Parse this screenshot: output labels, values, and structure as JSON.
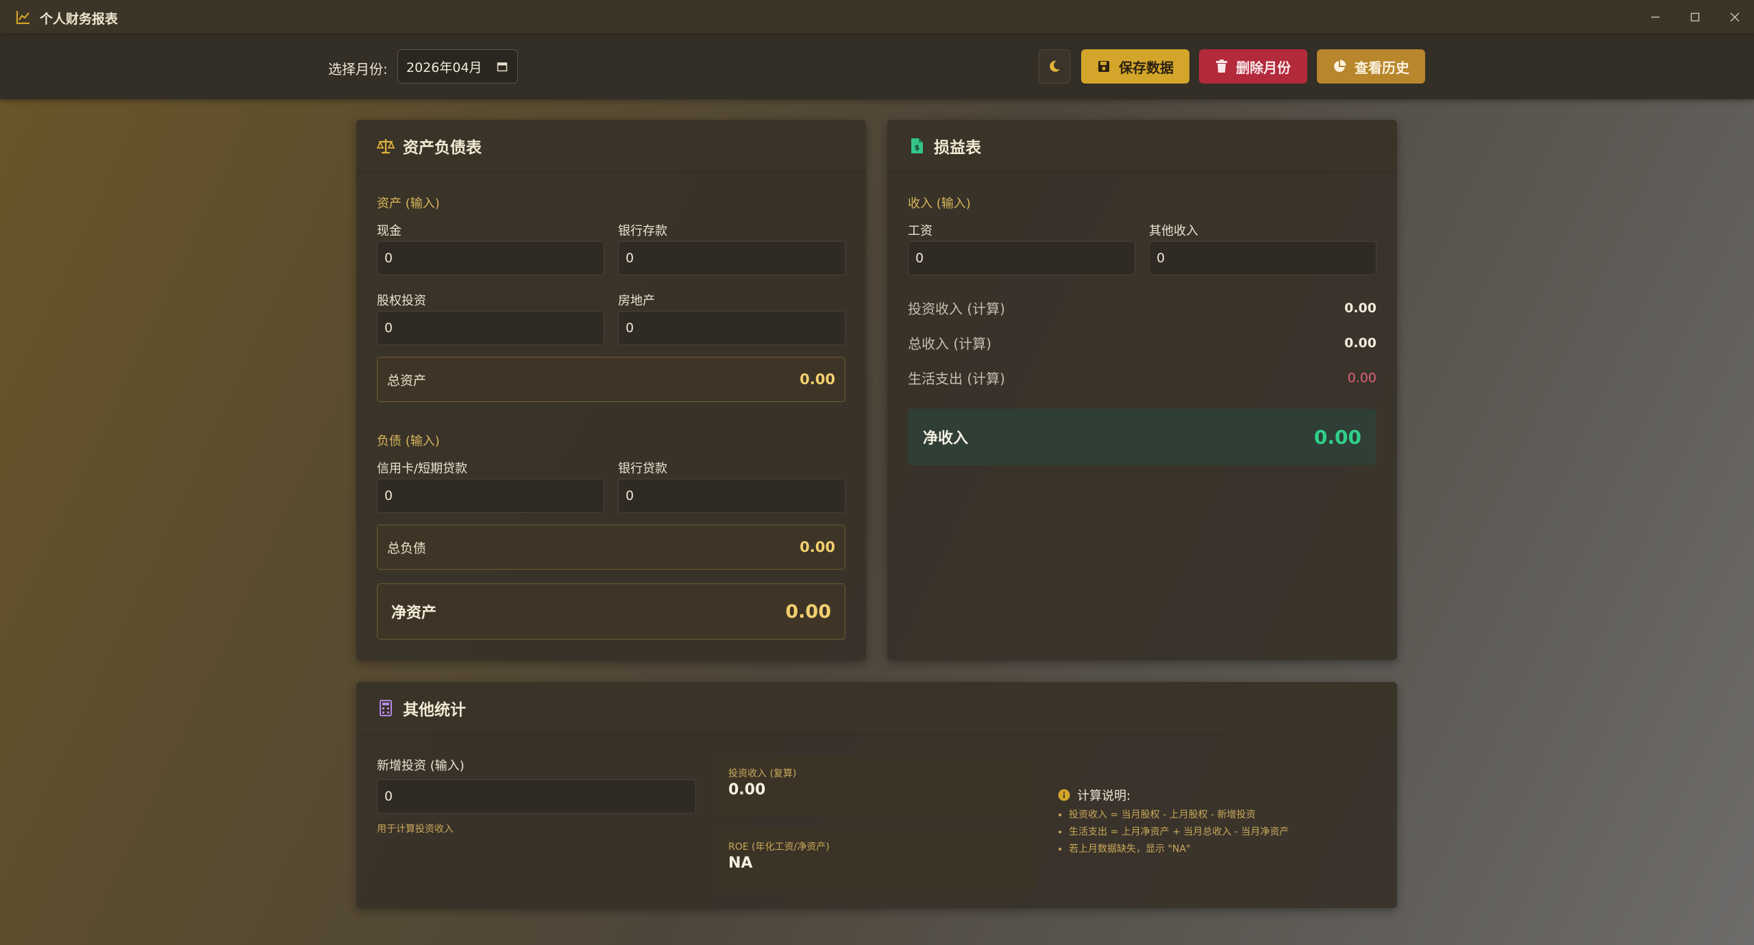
{
  "window": {
    "title": "个人财务报表"
  },
  "toolbar": {
    "month_label": "选择月份:",
    "month_value": "2026年04月",
    "save_label": "保存数据",
    "delete_label": "删除月份",
    "history_label": "查看历史"
  },
  "balance_sheet": {
    "title": "资产负债表",
    "assets_section": "资产 (输入)",
    "cash_label": "现金",
    "cash_value": "0",
    "bank_deposit_label": "银行存款",
    "bank_deposit_value": "0",
    "equity_label": "股权投资",
    "equity_value": "0",
    "real_estate_label": "房地产",
    "real_estate_value": "0",
    "total_assets_label": "总资产",
    "total_assets_value": "0.00",
    "liabilities_section": "负债 (输入)",
    "credit_label": "信用卡/短期贷款",
    "credit_value": "0",
    "bank_loan_label": "银行贷款",
    "bank_loan_value": "0",
    "total_liabilities_label": "总负债",
    "total_liabilities_value": "0.00",
    "net_assets_label": "净资产",
    "net_assets_value": "0.00"
  },
  "income_statement": {
    "title": "损益表",
    "income_section": "收入 (输入)",
    "salary_label": "工资",
    "salary_value": "0",
    "other_income_label": "其他收入",
    "other_income_value": "0",
    "investment_income_label": "投资收入 (计算)",
    "investment_income_value": "0.00",
    "total_income_label": "总收入 (计算)",
    "total_income_value": "0.00",
    "living_expense_label": "生活支出 (计算)",
    "living_expense_value": "0.00",
    "net_income_label": "净收入",
    "net_income_value": "0.00"
  },
  "other_stats": {
    "title": "其他统计",
    "new_investment_label": "新增投资 (输入)",
    "new_investment_value": "0",
    "new_investment_hint": "用于计算投资收入",
    "investment_income_label": "投资收入 (复算)",
    "investment_income_value": "0.00",
    "roe_label": "ROE (年化工资/净资产)",
    "roe_value": "NA",
    "notes_title": "计算说明:",
    "notes": [
      "投资收入 = 当月股权 - 上月股权 - 新增投资",
      "生活支出 = 上月净资产 + 当月总收入 - 当月净资产",
      "若上月数据缺失，显示 \"NA\""
    ]
  },
  "colors": {
    "accent_gold": "#d3a52a",
    "danger": "#b32a3b",
    "history": "#b8862c",
    "positive_green": "#2fd08a",
    "expense_red": "#e0627a"
  },
  "icons": {
    "app": "chart-line-icon",
    "theme": "moon-icon",
    "save": "floppy-icon",
    "delete": "trash-icon",
    "history": "pie-chart-icon",
    "balance": "scale-icon",
    "income": "file-invoice-icon",
    "stats": "calculator-icon",
    "info": "info-circle-icon"
  }
}
